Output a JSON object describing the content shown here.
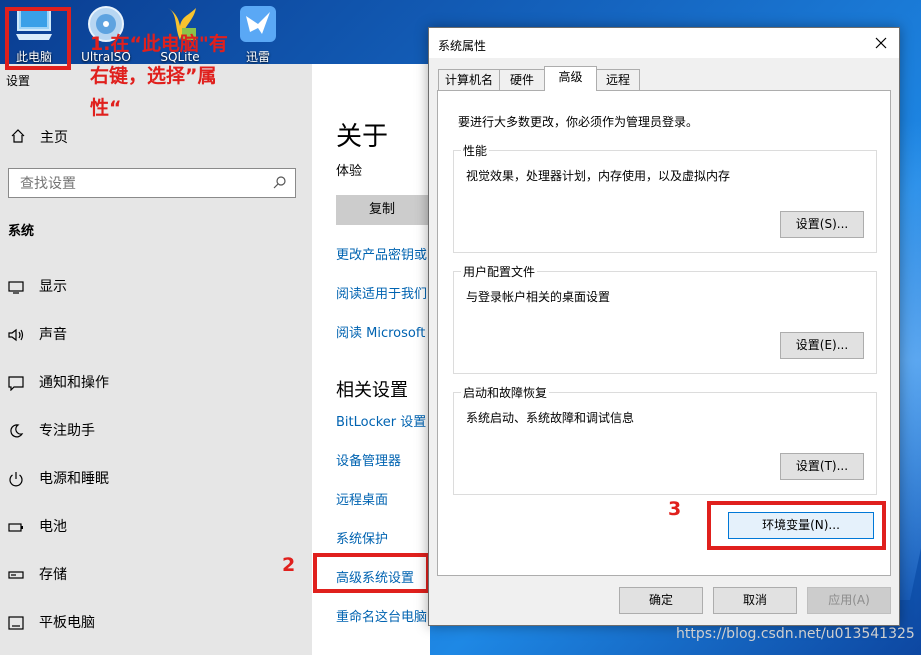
{
  "desktop": {
    "icons": [
      {
        "label": "此电脑",
        "icon": "computer-icon"
      },
      {
        "label": "UltraISO",
        "icon": "disc-icon"
      },
      {
        "label": "SQLite",
        "icon": "sqlite-feather-icon"
      },
      {
        "label": "迅雷",
        "icon": "bird-icon"
      }
    ]
  },
  "annotations": {
    "step1": "1.在“此电脑\"有右键，选择”属性“",
    "step2": "2",
    "step3": "3",
    "accent": "#e0201d"
  },
  "settings": {
    "app_title": "设置",
    "home_label": "主页",
    "search_placeholder": "查找设置",
    "section": "系统",
    "nav": [
      {
        "label": "显示",
        "icon": "monitor-icon"
      },
      {
        "label": "声音",
        "icon": "speaker-icon"
      },
      {
        "label": "通知和操作",
        "icon": "notification-icon"
      },
      {
        "label": "专注助手",
        "icon": "moon-icon"
      },
      {
        "label": "电源和睡眠",
        "icon": "power-icon"
      },
      {
        "label": "电池",
        "icon": "battery-icon"
      },
      {
        "label": "存储",
        "icon": "storage-icon"
      },
      {
        "label": "平板电脑",
        "icon": "tablet-icon"
      }
    ],
    "main": {
      "title": "关于",
      "subtitle": "体验",
      "copy_button": "复制",
      "links_top": [
        "更改产品密钥或",
        "阅读适用于我们",
        "阅读 Microsoft"
      ],
      "related_title": "相关设置",
      "related_links": [
        "BitLocker 设置",
        "设备管理器",
        "远程桌面",
        "系统保护",
        "高级系统设置",
        "重命名这台电脑"
      ]
    }
  },
  "dialog": {
    "title": "系统属性",
    "tabs": [
      "计算机名",
      "硬件",
      "高级",
      "远程"
    ],
    "active_tab": "高级",
    "admin_note": "要进行大多数更改，你必须作为管理员登录。",
    "groups": [
      {
        "title": "性能",
        "desc": "视觉效果，处理器计划，内存使用，以及虚拟内存",
        "button": "设置(S)..."
      },
      {
        "title": "用户配置文件",
        "desc": "与登录帐户相关的桌面设置",
        "button": "设置(E)..."
      },
      {
        "title": "启动和故障恢复",
        "desc": "系统启动、系统故障和调试信息",
        "button": "设置(T)..."
      }
    ],
    "env_button": "环境变量(N)...",
    "ok": "确定",
    "cancel": "取消",
    "apply": "应用(A)"
  },
  "watermark": "https://blog.csdn.net/u013541325"
}
